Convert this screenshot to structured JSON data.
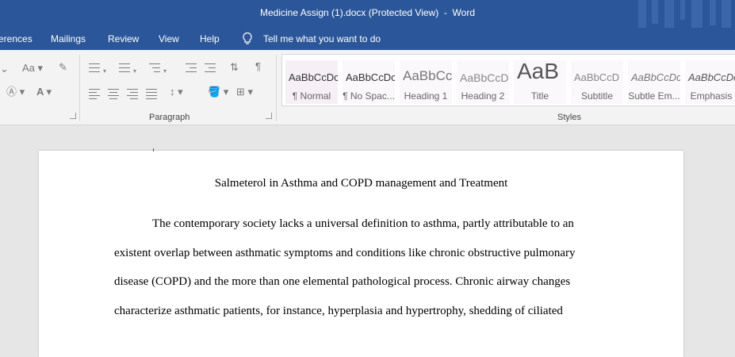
{
  "window": {
    "title": "Medicine Assign (1).docx (Protected View)  -  Word"
  },
  "menu": {
    "items": [
      "erences",
      "Mailings",
      "Review",
      "View",
      "Help"
    ],
    "tell_me": "Tell me what you want to do"
  },
  "ribbon": {
    "font_group_icons": {
      "font_size_label": "Aa",
      "highlight_label": "A",
      "font_color_label": "A"
    },
    "paragraph_label": "Paragraph",
    "styles_label": "Styles",
    "styles": [
      {
        "sample": "AaBbCcDc",
        "name": "¶ Normal"
      },
      {
        "sample": "AaBbCcDc",
        "name": "¶ No Spac..."
      },
      {
        "sample": "AaBbCc",
        "name": "Heading 1"
      },
      {
        "sample": "AaBbCcD",
        "name": "Heading 2"
      },
      {
        "sample": "AaB",
        "name": "Title"
      },
      {
        "sample": "AaBbCcD",
        "name": "Subtitle"
      },
      {
        "sample": "AaBbCcDc",
        "name": "Subtle Em..."
      },
      {
        "sample": "AaBbCcDc",
        "name": "Emphasis"
      }
    ]
  },
  "document": {
    "title": "Salmeterol in Asthma and COPD management and Treatment",
    "lines": [
      "The contemporary society lacks a universal definition to asthma, partly attributable to an",
      "existent overlap between asthmatic symptoms and conditions like chronic obstructive pulmonary",
      "disease (COPD) and the more than one elemental pathological process. Chronic airway changes",
      "characterize asthmatic patients, for instance, hyperplasia and hypertrophy, shedding of ciliated"
    ]
  }
}
